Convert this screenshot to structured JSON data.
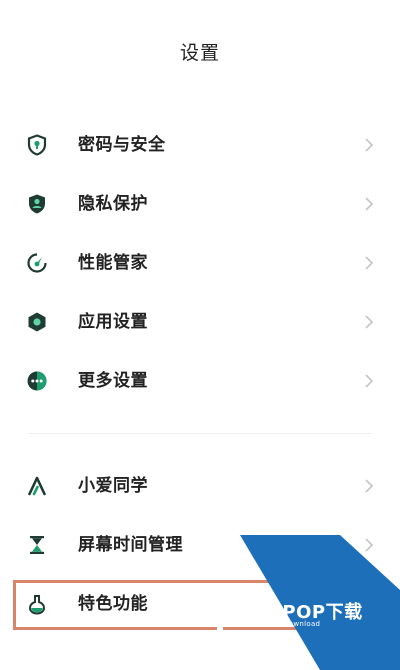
{
  "page": {
    "title": "设置"
  },
  "group1": [
    {
      "label": "密码与安全",
      "icon": "shield-lock-icon"
    },
    {
      "label": "隐私保护",
      "icon": "privacy-user-shield-icon"
    },
    {
      "label": "性能管家",
      "icon": "performance-gauge-icon"
    },
    {
      "label": "应用设置",
      "icon": "app-hexagon-icon"
    },
    {
      "label": "更多设置",
      "icon": "more-dots-icon"
    }
  ],
  "group2": [
    {
      "label": "小爱同学",
      "icon": "xiaoai-assistant-icon"
    },
    {
      "label": "屏幕时间管理",
      "icon": "hourglass-icon"
    },
    {
      "label": "特色功能",
      "icon": "flask-icon"
    }
  ],
  "highlight": {
    "color": "#d9856a",
    "target": "特色功能"
  },
  "watermark": {
    "text": "PCPOP下载",
    "subtext": "PCPOP Download",
    "color": "#1c6fb8"
  },
  "colors": {
    "accent": "#1e9e6e",
    "dark_icon": "#1f3b33",
    "chevron": "#c4c4c4"
  }
}
